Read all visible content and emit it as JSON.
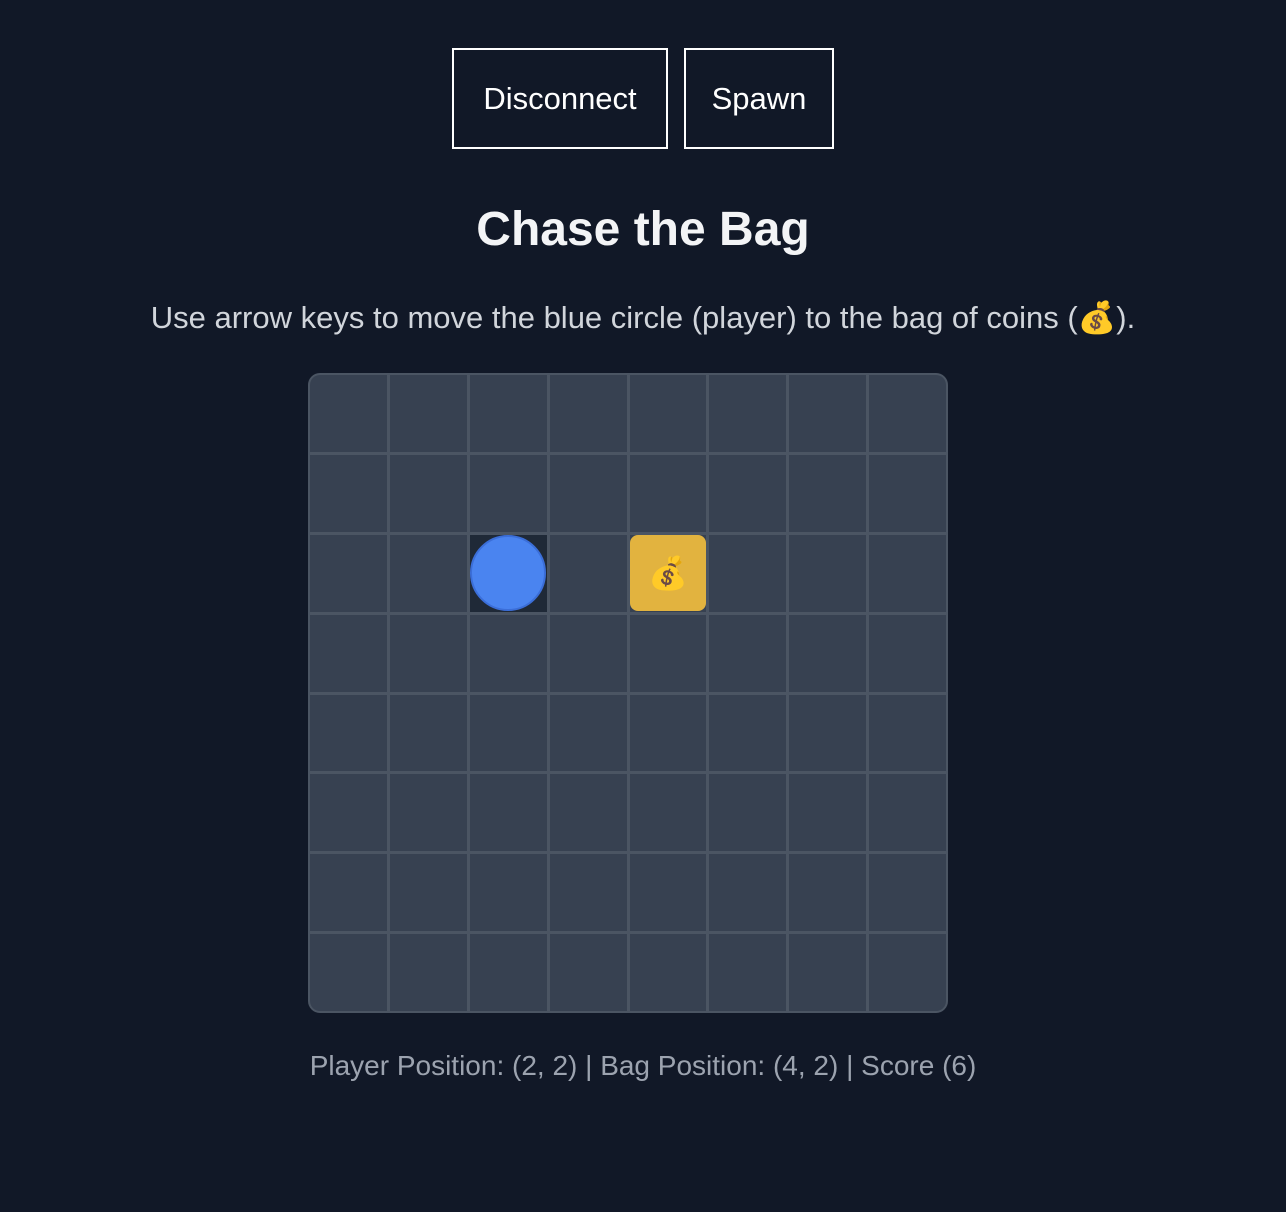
{
  "toolbar": {
    "disconnect_label": "Disconnect",
    "spawn_label": "Spawn"
  },
  "game": {
    "title": "Chase the Bag",
    "instructions": "Use arrow keys to move the blue circle (player) to the bag of coins (💰).",
    "grid_size": 8,
    "player": {
      "x": 2,
      "y": 2,
      "color": "#4a84f0"
    },
    "bag": {
      "x": 4,
      "y": 2,
      "symbol": "💰",
      "color": "#e2b33f"
    },
    "status_text": "Player Position: (2, 2) | Bag Position: (4, 2) | Score (6)"
  },
  "colors": {
    "background": "#111827",
    "cell": "#374151",
    "grid_line": "#4b5563"
  }
}
